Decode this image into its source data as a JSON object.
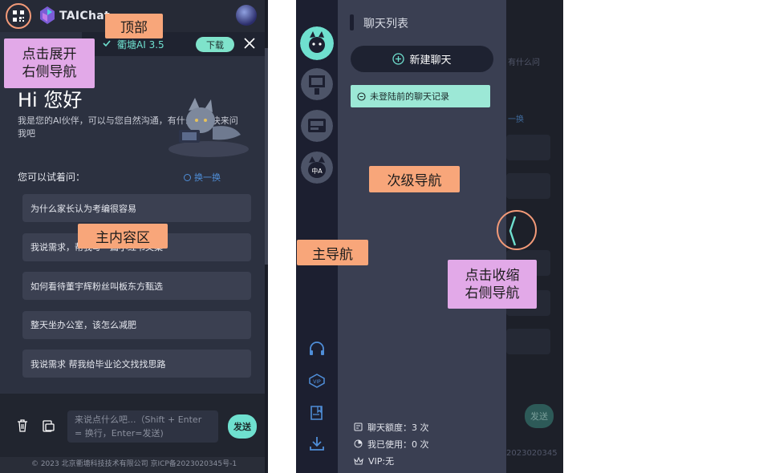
{
  "left_phone": {
    "brand": "TAIChat",
    "model_name": "衢塘AI 3.5",
    "download_label": "下载",
    "greeting": "Hi 您好",
    "intro": "我是您的AI伙伴，可以与您自然沟通，有什么问题快来问我吧",
    "try_label": "您可以试着问：",
    "refresh_label": "换一换",
    "questions": [
      "为什么家长认为考编很容易",
      "我说需求，帮我写一篇小红书文案",
      "如何看待董宇辉粉丝叫板东方甄选",
      "整天坐办公室，该怎么减肥",
      "我说需求 帮我给毕业论文找找思路"
    ],
    "input_placeholder": "来说点什么吧...（Shift + Enter = 换行，Enter=发送)",
    "send_label": "发送",
    "footer": "© 2023 北京衢塘科技技术有限公司   京ICP备2023020345号-1"
  },
  "annotations": {
    "top": "顶部",
    "expand_line1": "点击展开",
    "expand_line2": "右侧导航",
    "main_content": "主内容区",
    "secondary_nav": "次级导航",
    "main_nav": "主导航",
    "collapse_line1": "点击收缩",
    "collapse_line2": "右侧导航"
  },
  "right_phone": {
    "chat_list_title": "聊天列表",
    "new_chat_label": "新建聊天",
    "history_label": "未登陆前的聊天记录",
    "stat_quota": "聊天额度：3 次",
    "stat_used": "我已使用：0 次",
    "stat_vip": "VIP:无",
    "behind_text1": "有什么问",
    "behind_text2": "一换",
    "behind_send": "发送",
    "behind_footer": "2023020345"
  },
  "colors": {
    "accent": "#6fe0cf",
    "annotation_orange": "#f8a67a",
    "annotation_purple": "#e2a9e8",
    "panel_bg": "#2c3140"
  }
}
